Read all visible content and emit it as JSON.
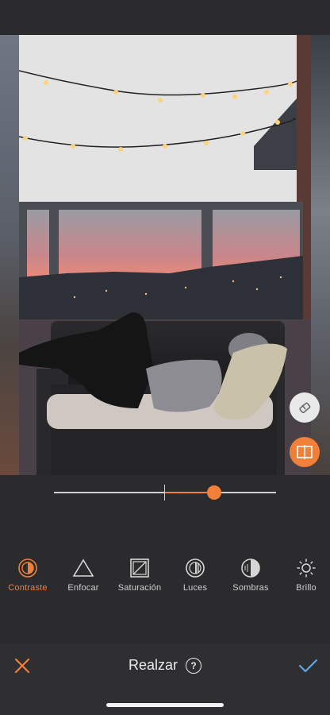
{
  "editor": {
    "photo_label": "Edited photo preview",
    "slider": {
      "value": 0.44,
      "min": -1,
      "max": 1
    }
  },
  "tools": [
    {
      "label": "Contraste",
      "icon": "contrast-icon",
      "active": true
    },
    {
      "label": "Enfocar",
      "icon": "sharpen-icon",
      "active": false
    },
    {
      "label": "Saturación",
      "icon": "saturation-icon",
      "active": false
    },
    {
      "label": "Luces",
      "icon": "highlights-icon",
      "active": false
    },
    {
      "label": "Sombras",
      "icon": "shadows-icon",
      "active": false
    },
    {
      "label": "Brillo",
      "icon": "brightness-icon",
      "active": false
    }
  ],
  "bottom_bar": {
    "title": "Realzar",
    "help_glyph": "?"
  },
  "colors": {
    "accent": "#f07f3a",
    "confirm": "#5aa9e6",
    "background": "#2b2b2d"
  }
}
